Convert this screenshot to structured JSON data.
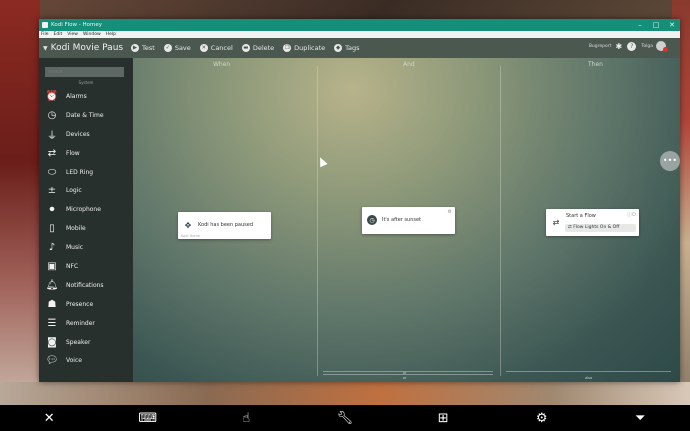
{
  "window": {
    "title": "Kodi Flow - Homey"
  },
  "menubar": [
    "File",
    "Edit",
    "View",
    "Window",
    "Help"
  ],
  "toolbar": {
    "flow_title": "Kodi Movie Paus",
    "buttons": {
      "test": "Test",
      "save": "Save",
      "cancel": "Cancel",
      "delete": "Delete",
      "duplicate": "Duplicate",
      "tags": "Tags"
    },
    "bugreport": "Bugreport",
    "user": "Tolga"
  },
  "sidebar": {
    "search_placeholder": "Search",
    "section_label": "System",
    "items": [
      {
        "label": "Alarms",
        "icon": "alarm-clock-icon"
      },
      {
        "label": "Date & Time",
        "icon": "clock-icon"
      },
      {
        "label": "Devices",
        "icon": "plug-icon"
      },
      {
        "label": "Flow",
        "icon": "flow-icon"
      },
      {
        "label": "LED Ring",
        "icon": "led-ring-icon"
      },
      {
        "label": "Logic",
        "icon": "logic-icon"
      },
      {
        "label": "Microphone",
        "icon": "microphone-icon"
      },
      {
        "label": "Mobile",
        "icon": "mobile-icon"
      },
      {
        "label": "Music",
        "icon": "music-note-icon"
      },
      {
        "label": "NFC",
        "icon": "nfc-icon"
      },
      {
        "label": "Notifications",
        "icon": "bell-icon"
      },
      {
        "label": "Presence",
        "icon": "presence-icon"
      },
      {
        "label": "Reminder",
        "icon": "reminder-icon"
      },
      {
        "label": "Speaker",
        "icon": "speaker-icon"
      },
      {
        "label": "Voice",
        "icon": "speech-bubble-icon"
      }
    ]
  },
  "columns": {
    "when": "When",
    "and": "And",
    "then": "Then"
  },
  "cards": {
    "when": {
      "text": "Kodi has been paused",
      "sub": "Kodi Home"
    },
    "and": {
      "text": "It's after sunset"
    },
    "then": {
      "text": "Start a Flow",
      "field": "Flow Lights On & Off"
    }
  },
  "footer": {
    "and_a": "or",
    "and_b": "or",
    "then": "also"
  },
  "colors": {
    "titlebar": "#168f7a",
    "accent_red": "#e0302a"
  }
}
